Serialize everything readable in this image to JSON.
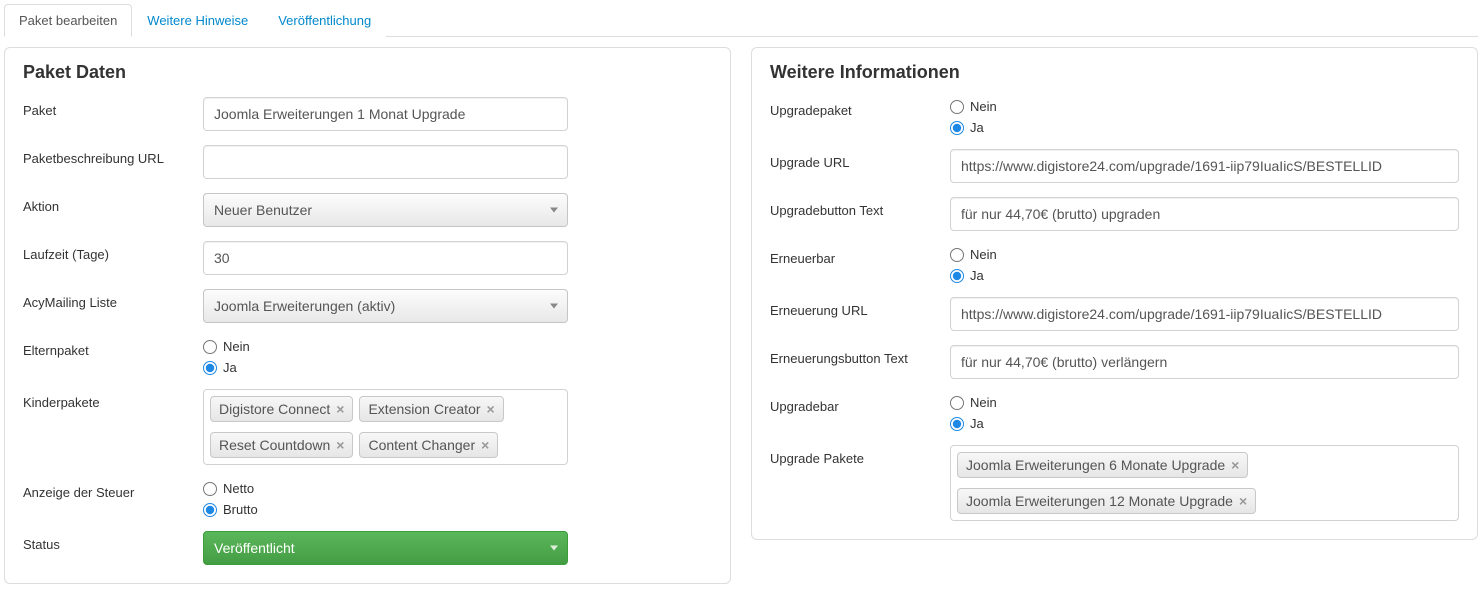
{
  "tabs": [
    "Paket bearbeiten",
    "Weitere Hinweise",
    "Veröffentlichung"
  ],
  "activeTab": 0,
  "left": {
    "title": "Paket Daten",
    "paketLabel": "Paket",
    "paketValue": "Joomla Erweiterungen 1 Monat Upgrade",
    "urlLabel": "Paketbeschreibung URL",
    "urlValue": "",
    "aktionLabel": "Aktion",
    "aktionValue": "Neuer Benutzer",
    "laufzeitLabel": "Laufzeit (Tage)",
    "laufzeitValue": "30",
    "acyLabel": "AcyMailing Liste",
    "acyValue": "Joomla Erweiterungen (aktiv)",
    "elternLabel": "Elternpaket",
    "elternOptions": {
      "no": "Nein",
      "yes": "Ja"
    },
    "elternSelected": "yes",
    "kinderLabel": "Kinderpakete",
    "kinderTags": [
      "Digistore Connect",
      "Extension Creator",
      "Reset Countdown",
      "Content Changer"
    ],
    "steuerLabel": "Anzeige der Steuer",
    "steuerOptions": {
      "netto": "Netto",
      "brutto": "Brutto"
    },
    "steuerSelected": "brutto",
    "statusLabel": "Status",
    "statusValue": "Veröffentlicht"
  },
  "right": {
    "title": "Weitere Informationen",
    "upgradePaketLabel": "Upgradepaket",
    "upgradePaketSelected": "yes",
    "upgradeUrlLabel": "Upgrade URL",
    "upgradeUrlValue": "https://www.digistore24.com/upgrade/1691-iip79IuaIicS/BESTELLID",
    "upgradeBtnLabel": "Upgradebutton Text",
    "upgradeBtnValue": "für nur 44,70€ (brutto) upgraden",
    "erneuerbarLabel": "Erneuerbar",
    "erneuerbarSelected": "yes",
    "erneuerungUrlLabel": "Erneuerung URL",
    "erneuerungUrlValue": "https://www.digistore24.com/upgrade/1691-iip79IuaIicS/BESTELLID",
    "erneuerungBtnLabel": "Erneuerungsbutton Text",
    "erneuerungBtnValue": "für nur 44,70€ (brutto) verlängern",
    "upgradebarLabel": "Upgradebar",
    "upgradebarSelected": "yes",
    "upgradePaketeLabel": "Upgrade Pakete",
    "upgradePaketeTags": [
      "Joomla Erweiterungen 6 Monate Upgrade",
      "Joomla Erweiterungen 12 Monate Upgrade"
    ],
    "radioOptions": {
      "no": "Nein",
      "yes": "Ja"
    }
  }
}
